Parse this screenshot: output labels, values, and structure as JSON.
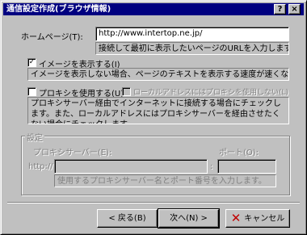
{
  "window": {
    "title": "通信設定作成(ブラウザ情報)",
    "help_button": "?",
    "close_button": "×"
  },
  "homepage": {
    "label": "ホームページ(T):",
    "value": "http://www.intertop.ne.jp/",
    "help": "接続して最初に表示したいページのURLを入力します。"
  },
  "images": {
    "label": "イメージを表示する(I)",
    "checked": true,
    "check_glyph": "✓",
    "help": "イメージを表示しない場合、ページのテキストを表示する速度が速くなります。"
  },
  "proxy": {
    "label": "プロキシを使用する(U)",
    "checked": false,
    "local_label": "ローカルアドレスにはプロキシを使用しない(L)",
    "help": "プロキシサーバー経由でインターネットに接続する場合にチェックします。また、ローカルアドレスにはプロキシサーバーを経由させたくない場合にチェックします。"
  },
  "settings": {
    "group_title": "設定",
    "server_label": "プロキシサーバー(E):",
    "port_label": "ポート(O):",
    "prefix": "http://",
    "colon": ":",
    "help": "使用するプロキシサーバー名とポート番号を入力します。"
  },
  "buttons": {
    "back": "< 戻る(B)",
    "next": "次へ(N) >",
    "cancel": "キャンセル",
    "cancel_icon": "✕"
  }
}
